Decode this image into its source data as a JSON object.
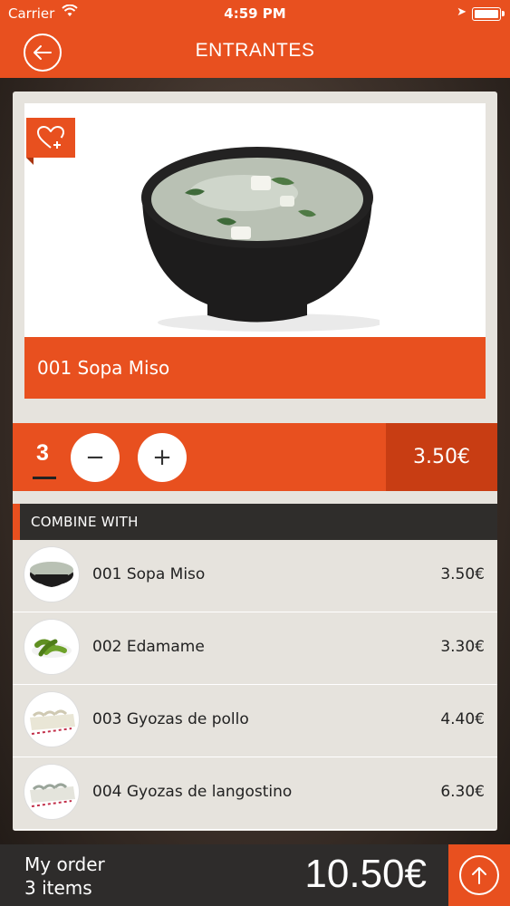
{
  "status": {
    "carrier": "Carrier",
    "time": "4:59 PM"
  },
  "nav": {
    "title": "ENTRANTES"
  },
  "product": {
    "name": "001 Sopa Miso",
    "quantity": "3",
    "price": "3.50€",
    "minus_label": "−",
    "plus_label": "+"
  },
  "combine": {
    "header": "COMBINE WITH",
    "items": [
      {
        "name": "001 Sopa Miso",
        "price": "3.50€"
      },
      {
        "name": "002 Edamame",
        "price": "3.30€"
      },
      {
        "name": "003 Gyozas de pollo",
        "price": "4.40€"
      },
      {
        "name": "004 Gyozas de langostino",
        "price": "6.30€"
      }
    ]
  },
  "footer": {
    "label": "My order",
    "count": "3 items",
    "total": "10.50€"
  },
  "colors": {
    "accent": "#e8501f",
    "accent_dark": "#c83d13",
    "dark": "#2e2c2b"
  }
}
